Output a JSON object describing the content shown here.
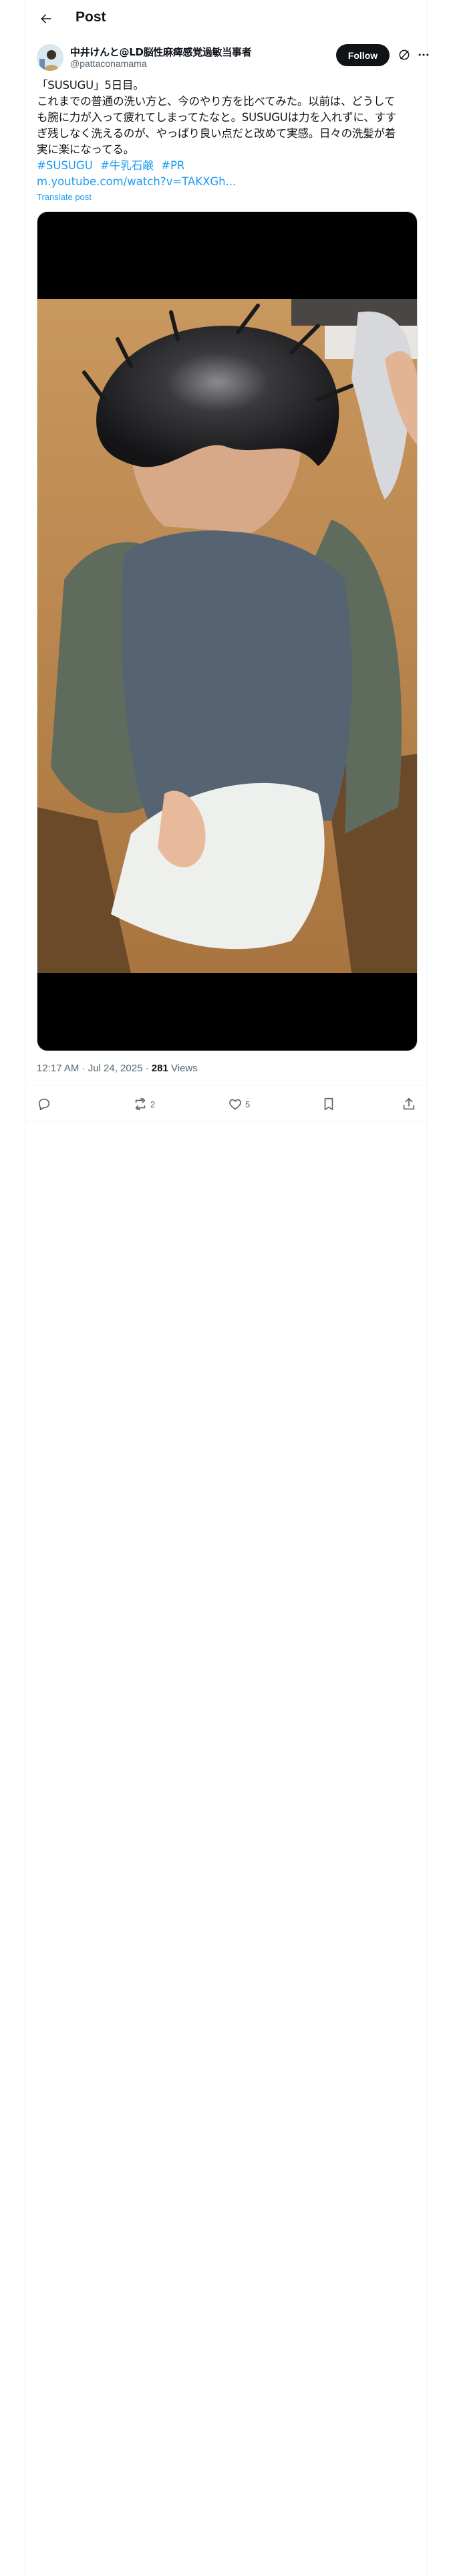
{
  "header": {
    "title": "Post",
    "back_icon": "arrow-left-icon"
  },
  "author": {
    "display_name": "中井けんと@LD脳性麻痺感覚過敏当事者",
    "handle": "@pattaconamama",
    "follow_label": "Follow"
  },
  "tweet": {
    "lines": [
      "「SUSUGU」5日目。",
      "これまでの普通の洗い方と、今のやり方を比べてみた。以前は、どうして",
      "も腕に力が入って疲れてしまってたなと。SUSUGUは力を入れずに、すす",
      "ぎ残しなく洗えるのが、やっぱり良い点だと改めて実感。日々の洗髪が着",
      "実に楽になってる。"
    ],
    "hashtags": [
      "#SUSUGU",
      "#牛乳石鹸",
      "#PR"
    ],
    "link": "m.youtube.com/watch?v=TAKXGh...",
    "translate_label": "Translate post"
  },
  "meta": {
    "time": "12:17 AM · Jul 24, 2025 · ",
    "views_count": "281",
    "views_label": " Views"
  },
  "actions": {
    "reply_count": "",
    "repost_count": "2",
    "like_count": "5"
  },
  "colors": {
    "accent": "#1d9bf0",
    "text": "#0f1419",
    "secondary": "#536471",
    "border": "#eff3f4"
  }
}
